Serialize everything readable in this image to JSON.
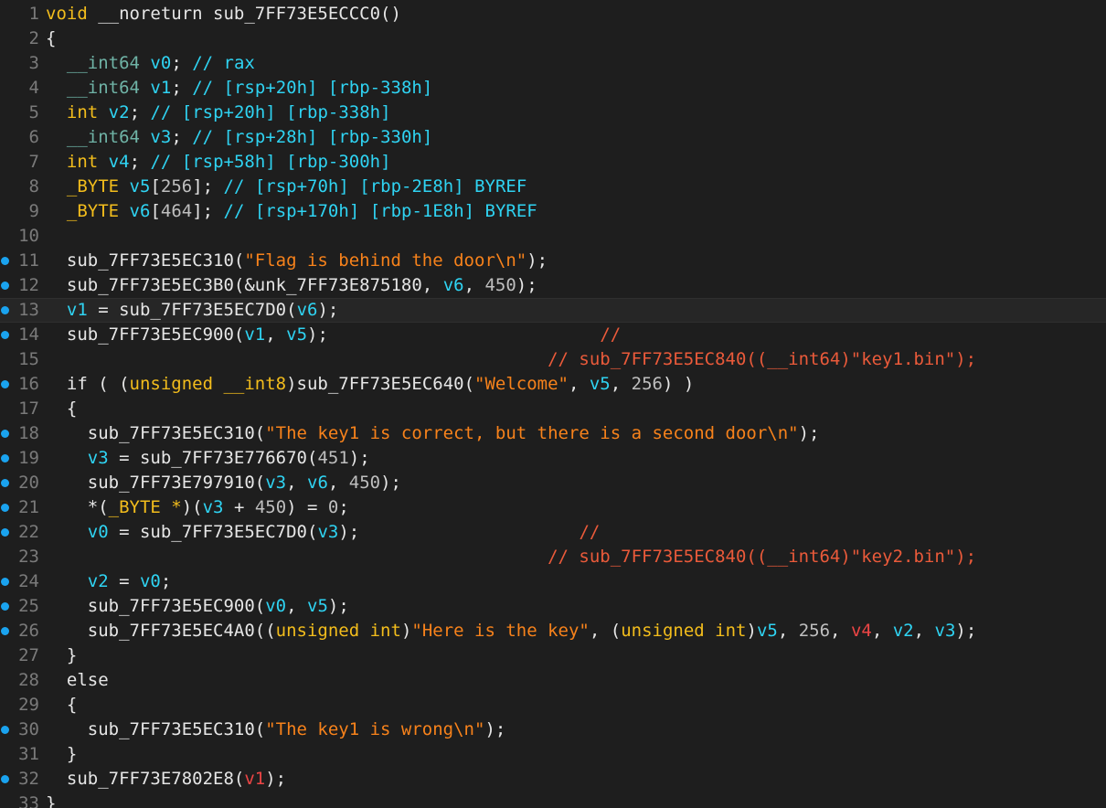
{
  "editor": {
    "current_line": 13,
    "lines": [
      {
        "num": "1",
        "bp": false,
        "tokens": [
          [
            "kw",
            "void"
          ],
          [
            "p",
            " __noreturn sub_7FF73E5ECCC0()"
          ]
        ]
      },
      {
        "num": "2",
        "bp": false,
        "tokens": [
          [
            "p",
            "{"
          ]
        ]
      },
      {
        "num": "3",
        "bp": false,
        "tokens": [
          [
            "p",
            "  "
          ],
          [
            "ty",
            "__int64"
          ],
          [
            "p",
            " "
          ],
          [
            "v",
            "v0"
          ],
          [
            "p",
            "; "
          ],
          [
            "c",
            "// rax"
          ]
        ]
      },
      {
        "num": "4",
        "bp": false,
        "tokens": [
          [
            "p",
            "  "
          ],
          [
            "ty",
            "__int64"
          ],
          [
            "p",
            " "
          ],
          [
            "v",
            "v1"
          ],
          [
            "p",
            "; "
          ],
          [
            "c",
            "// [rsp+20h] [rbp-338h]"
          ]
        ]
      },
      {
        "num": "5",
        "bp": false,
        "tokens": [
          [
            "p",
            "  "
          ],
          [
            "kw",
            "int"
          ],
          [
            "p",
            " "
          ],
          [
            "v",
            "v2"
          ],
          [
            "p",
            "; "
          ],
          [
            "c",
            "// [rsp+20h] [rbp-338h]"
          ]
        ]
      },
      {
        "num": "6",
        "bp": false,
        "tokens": [
          [
            "p",
            "  "
          ],
          [
            "ty",
            "__int64"
          ],
          [
            "p",
            " "
          ],
          [
            "v",
            "v3"
          ],
          [
            "p",
            "; "
          ],
          [
            "c",
            "// [rsp+28h] [rbp-330h]"
          ]
        ]
      },
      {
        "num": "7",
        "bp": false,
        "tokens": [
          [
            "p",
            "  "
          ],
          [
            "kw",
            "int"
          ],
          [
            "p",
            " "
          ],
          [
            "v",
            "v4"
          ],
          [
            "p",
            "; "
          ],
          [
            "c",
            "// [rsp+58h] [rbp-300h]"
          ]
        ]
      },
      {
        "num": "8",
        "bp": false,
        "tokens": [
          [
            "p",
            "  "
          ],
          [
            "kw",
            "_BYTE"
          ],
          [
            "p",
            " "
          ],
          [
            "v",
            "v5"
          ],
          [
            "p",
            "["
          ],
          [
            "n",
            "256"
          ],
          [
            "p",
            "]; "
          ],
          [
            "c",
            "// [rsp+70h] [rbp-2E8h] BYREF"
          ]
        ]
      },
      {
        "num": "9",
        "bp": false,
        "tokens": [
          [
            "p",
            "  "
          ],
          [
            "kw",
            "_BYTE"
          ],
          [
            "p",
            " "
          ],
          [
            "v",
            "v6"
          ],
          [
            "p",
            "["
          ],
          [
            "n",
            "464"
          ],
          [
            "p",
            "]; "
          ],
          [
            "c",
            "// [rsp+170h] [rbp-1E8h] BYREF"
          ]
        ]
      },
      {
        "num": "10",
        "bp": false,
        "tokens": []
      },
      {
        "num": "11",
        "bp": true,
        "tokens": [
          [
            "p",
            "  sub_7FF73E5EC310("
          ],
          [
            "s",
            "\"Flag is behind the door\\n\""
          ],
          [
            "p",
            ");"
          ]
        ]
      },
      {
        "num": "12",
        "bp": true,
        "tokens": [
          [
            "p",
            "  sub_7FF73E5EC3B0(&unk_7FF73E875180, "
          ],
          [
            "v",
            "v6"
          ],
          [
            "p",
            ", "
          ],
          [
            "n",
            "450"
          ],
          [
            "p",
            ");"
          ]
        ]
      },
      {
        "num": "13",
        "bp": true,
        "tokens": [
          [
            "p",
            "  "
          ],
          [
            "v",
            "v1"
          ],
          [
            "p",
            " = sub_7FF73E5EC7D0("
          ],
          [
            "v",
            "v6"
          ],
          [
            "p",
            ");"
          ]
        ]
      },
      {
        "num": "14",
        "bp": true,
        "tokens": [
          [
            "p",
            "  sub_7FF73E5EC900("
          ],
          [
            "v",
            "v1"
          ],
          [
            "p",
            ", "
          ],
          [
            "v",
            "v5"
          ],
          [
            "p",
            ");                          "
          ],
          [
            "cr",
            "//"
          ]
        ]
      },
      {
        "num": "15",
        "bp": false,
        "tokens": [
          [
            "p",
            "                                                "
          ],
          [
            "cr",
            "// sub_7FF73E5EC840((__int64)\"key1.bin\");"
          ]
        ]
      },
      {
        "num": "16",
        "bp": true,
        "tokens": [
          [
            "p",
            "  if ( ("
          ],
          [
            "kw",
            "unsigned __int8"
          ],
          [
            "p",
            ")sub_7FF73E5EC640("
          ],
          [
            "s",
            "\"Welcome\""
          ],
          [
            "p",
            ", "
          ],
          [
            "v",
            "v5"
          ],
          [
            "p",
            ", "
          ],
          [
            "n",
            "256"
          ],
          [
            "p",
            ") )"
          ]
        ]
      },
      {
        "num": "17",
        "bp": false,
        "tokens": [
          [
            "p",
            "  {"
          ]
        ]
      },
      {
        "num": "18",
        "bp": true,
        "tokens": [
          [
            "p",
            "    sub_7FF73E5EC310("
          ],
          [
            "s",
            "\"The key1 is correct, but there is a second door\\n\""
          ],
          [
            "p",
            ");"
          ]
        ]
      },
      {
        "num": "19",
        "bp": true,
        "tokens": [
          [
            "p",
            "    "
          ],
          [
            "v",
            "v3"
          ],
          [
            "p",
            " = sub_7FF73E776670("
          ],
          [
            "n",
            "451"
          ],
          [
            "p",
            ");"
          ]
        ]
      },
      {
        "num": "20",
        "bp": true,
        "tokens": [
          [
            "p",
            "    sub_7FF73E797910("
          ],
          [
            "v",
            "v3"
          ],
          [
            "p",
            ", "
          ],
          [
            "v",
            "v6"
          ],
          [
            "p",
            ", "
          ],
          [
            "n",
            "450"
          ],
          [
            "p",
            ");"
          ]
        ]
      },
      {
        "num": "21",
        "bp": true,
        "tokens": [
          [
            "p",
            "    *("
          ],
          [
            "kw",
            "_BYTE *"
          ],
          [
            "p",
            ")("
          ],
          [
            "v",
            "v3"
          ],
          [
            "p",
            " + "
          ],
          [
            "n",
            "450"
          ],
          [
            "p",
            ") = "
          ],
          [
            "n",
            "0"
          ],
          [
            "p",
            ";"
          ]
        ]
      },
      {
        "num": "22",
        "bp": true,
        "tokens": [
          [
            "p",
            "    "
          ],
          [
            "v",
            "v0"
          ],
          [
            "p",
            " = sub_7FF73E5EC7D0("
          ],
          [
            "v",
            "v3"
          ],
          [
            "p",
            ");                     "
          ],
          [
            "cr",
            "//"
          ]
        ]
      },
      {
        "num": "23",
        "bp": false,
        "tokens": [
          [
            "p",
            "                                                "
          ],
          [
            "cr",
            "// sub_7FF73E5EC840((__int64)\"key2.bin\");"
          ]
        ]
      },
      {
        "num": "24",
        "bp": true,
        "tokens": [
          [
            "p",
            "    "
          ],
          [
            "v",
            "v2"
          ],
          [
            "p",
            " = "
          ],
          [
            "v",
            "v0"
          ],
          [
            "p",
            ";"
          ]
        ]
      },
      {
        "num": "25",
        "bp": true,
        "tokens": [
          [
            "p",
            "    sub_7FF73E5EC900("
          ],
          [
            "v",
            "v0"
          ],
          [
            "p",
            ", "
          ],
          [
            "v",
            "v5"
          ],
          [
            "p",
            ");"
          ]
        ]
      },
      {
        "num": "26",
        "bp": true,
        "tokens": [
          [
            "p",
            "    sub_7FF73E5EC4A0(("
          ],
          [
            "kw",
            "unsigned int"
          ],
          [
            "p",
            ")"
          ],
          [
            "s",
            "\"Here is the key\""
          ],
          [
            "p",
            ", ("
          ],
          [
            "kw",
            "unsigned int"
          ],
          [
            "p",
            ")"
          ],
          [
            "v",
            "v5"
          ],
          [
            "p",
            ", "
          ],
          [
            "n",
            "256"
          ],
          [
            "p",
            ", "
          ],
          [
            "vr",
            "v4"
          ],
          [
            "p",
            ", "
          ],
          [
            "v",
            "v2"
          ],
          [
            "p",
            ", "
          ],
          [
            "v",
            "v3"
          ],
          [
            "p",
            ");"
          ]
        ]
      },
      {
        "num": "27",
        "bp": false,
        "tokens": [
          [
            "p",
            "  }"
          ]
        ]
      },
      {
        "num": "28",
        "bp": false,
        "tokens": [
          [
            "p",
            "  else"
          ]
        ]
      },
      {
        "num": "29",
        "bp": false,
        "tokens": [
          [
            "p",
            "  {"
          ]
        ]
      },
      {
        "num": "30",
        "bp": true,
        "tokens": [
          [
            "p",
            "    sub_7FF73E5EC310("
          ],
          [
            "s",
            "\"The key1 is wrong\\n\""
          ],
          [
            "p",
            ");"
          ]
        ]
      },
      {
        "num": "31",
        "bp": false,
        "tokens": [
          [
            "p",
            "  }"
          ]
        ]
      },
      {
        "num": "32",
        "bp": true,
        "tokens": [
          [
            "p",
            "  sub_7FF73E7802E8("
          ],
          [
            "vr",
            "v1"
          ],
          [
            "p",
            ");"
          ]
        ]
      },
      {
        "num": "33",
        "bp": false,
        "tokens": [
          [
            "p",
            "}"
          ]
        ]
      }
    ]
  }
}
